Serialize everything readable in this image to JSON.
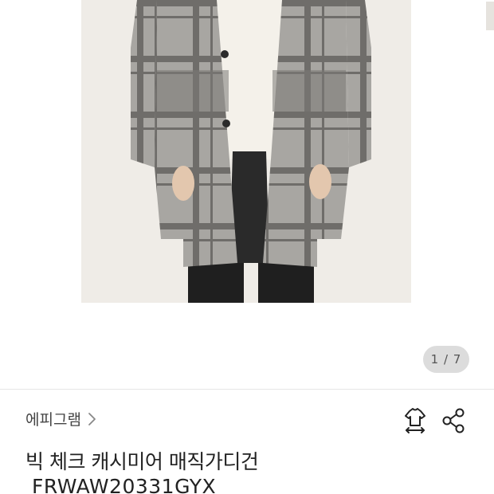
{
  "gallery": {
    "counter": "1 / 7",
    "image_alt": "Model wearing a long gray check cashmere cardigan"
  },
  "product": {
    "brand": "에피그램",
    "title": "빅 체크 캐시미어 매직가디건",
    "code": "FRWAW20331GYX"
  },
  "icons": {
    "brand_chevron": "chevron-right-icon",
    "closet": "tshirt-hanger-icon",
    "share": "share-icon"
  },
  "colors": {
    "counter_bg": "#dcdcdc",
    "photo_bg": "#efece7",
    "text": "#222222"
  }
}
